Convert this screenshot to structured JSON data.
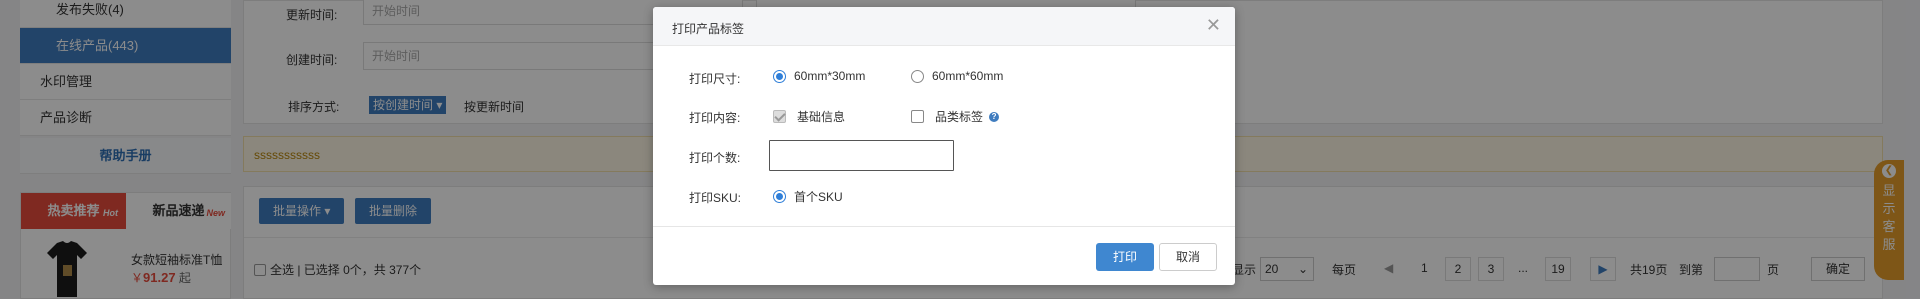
{
  "sidebar": {
    "items": [
      {
        "label": "发布失败(4)"
      },
      {
        "label": "在线产品(443)"
      },
      {
        "label": "水印管理"
      },
      {
        "label": "产品诊断"
      }
    ],
    "help_label": "帮助手册"
  },
  "promo": {
    "tab_hot": "热卖推荐",
    "tab_hot_badge": "Hot",
    "tab_new": "新品速递",
    "tab_new_badge": "New",
    "product_name": "女款短袖标准T恤",
    "price_symbol": "￥",
    "price": "91.27",
    "price_suffix": "起"
  },
  "filters": {
    "update_time_label": "更新时间:",
    "update_time_placeholder": "开始时间",
    "create_time_label": "创建时间:",
    "create_time_placeholder": "开始时间",
    "sort_label": "排序方式:",
    "sort_active": "按创建时间 ▾",
    "sort_other": "按更新时间"
  },
  "notice": "sssssssssss",
  "batch": {
    "batch_ops": "批量操作 ▾",
    "batch_delete": "批量删除",
    "select_all": "全选 | 已选择 0个，共 377个"
  },
  "pager": {
    "show_label": "显示",
    "page_size": "20",
    "per_page": "每页",
    "prev": "◀",
    "pages": [
      "1",
      "2",
      "3",
      "...",
      "19"
    ],
    "next": "▶",
    "total": "共19页",
    "goto": "到第",
    "page_unit": "页",
    "confirm": "确定"
  },
  "service": {
    "arrow": "❮",
    "chars": [
      "显",
      "示",
      "客",
      "服"
    ]
  },
  "dialog": {
    "title": "打印产品标签",
    "close": "✕",
    "size_label": "打印尺寸:",
    "size_options": [
      "60mm*30mm",
      "60mm*60mm"
    ],
    "size_selected": "60mm*30mm",
    "content_label": "打印内容:",
    "content_basic": "基础信息",
    "content_category": "品类标签",
    "help": "?",
    "count_label": "打印个数:",
    "count_value": "",
    "sku_label": "打印SKU:",
    "sku_option": "首个SKU",
    "print_button": "打印",
    "cancel_button": "取消"
  },
  "colors": {
    "accent": "#3f7cbf",
    "radio_on": "#2f7fd8",
    "hot": "#e84b3c",
    "service": "#e59d2a"
  }
}
